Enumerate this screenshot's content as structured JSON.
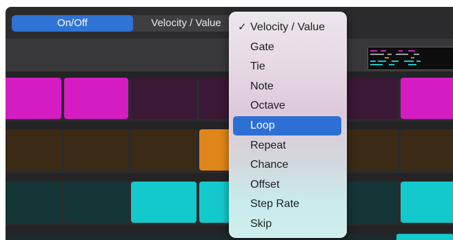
{
  "tabs": [
    {
      "label": "On/Off",
      "active": true
    },
    {
      "label": "Velocity / Value",
      "active": false
    }
  ],
  "menu": {
    "items": [
      {
        "label": "Velocity / Value",
        "checked": true,
        "highlighted": false
      },
      {
        "label": "Gate",
        "checked": false,
        "highlighted": false
      },
      {
        "label": "Tie",
        "checked": false,
        "highlighted": false
      },
      {
        "label": "Note",
        "checked": false,
        "highlighted": false
      },
      {
        "label": "Octave",
        "checked": false,
        "highlighted": false
      },
      {
        "label": "Loop",
        "checked": false,
        "highlighted": true
      },
      {
        "label": "Repeat",
        "checked": false,
        "highlighted": false
      },
      {
        "label": "Chance",
        "checked": false,
        "highlighted": false
      },
      {
        "label": "Offset",
        "checked": false,
        "highlighted": false
      },
      {
        "label": "Step Rate",
        "checked": false,
        "highlighted": false
      },
      {
        "label": "Skip",
        "checked": false,
        "highlighted": false
      }
    ],
    "check_glyph": "✓"
  },
  "grid": {
    "rows": [
      {
        "name": "pink-row",
        "on_color": "#d51cc3",
        "off_color": "#3a1836",
        "steps": [
          true,
          true,
          false,
          false,
          false,
          false,
          true,
          false
        ]
      },
      {
        "name": "orange-row",
        "on_color": "#e0861a",
        "off_color": "#3b2a16",
        "steps": [
          false,
          false,
          false,
          true,
          false,
          false,
          false,
          false
        ]
      },
      {
        "name": "cyan-row",
        "on_color": "#13c9cc",
        "off_color": "#143636",
        "steps": [
          false,
          false,
          true,
          true,
          false,
          false,
          true,
          false
        ]
      }
    ]
  }
}
